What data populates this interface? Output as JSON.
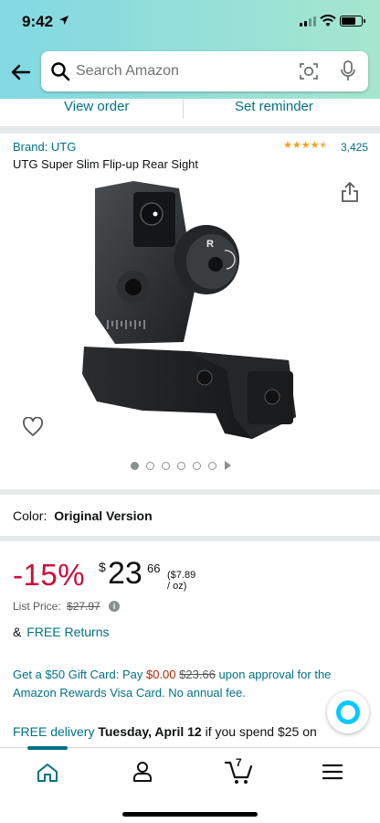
{
  "status_bar": {
    "time": "9:42"
  },
  "search": {
    "placeholder": "Search Amazon"
  },
  "order_actions": {
    "view_order": "View order",
    "set_reminder": "Set reminder"
  },
  "product": {
    "brand": "Brand: UTG",
    "rating": 4.5,
    "rating_count": "3,425",
    "title": "UTG Super Slim Flip-up Rear Sight",
    "image_count": 6,
    "active_image": 1
  },
  "color": {
    "label": "Color:",
    "value": "Original Version"
  },
  "pricing": {
    "discount": "-15%",
    "currency": "$",
    "whole": "23",
    "fraction": "66",
    "unit_price": "($7.89 / oz)",
    "list_label": "List Price:",
    "list_price": "$27.97",
    "returns_amp": "&",
    "returns_link": "FREE Returns"
  },
  "gift_card": {
    "text1": "Get a $50 Gift Card: Pay",
    "pay": "$0.00",
    "strike": "$23.66",
    "text2": "upon approval for the Amazon Rewards Visa Card. No annual fee."
  },
  "delivery": {
    "free": "FREE delivery",
    "date": "Tuesday, April 12",
    "condition": "if you spend $25 on"
  },
  "bottom_nav": {
    "cart_count": "7"
  },
  "colors": {
    "link": "#007185",
    "price_red": "#cc0c39",
    "star": "#ff9c1a"
  }
}
